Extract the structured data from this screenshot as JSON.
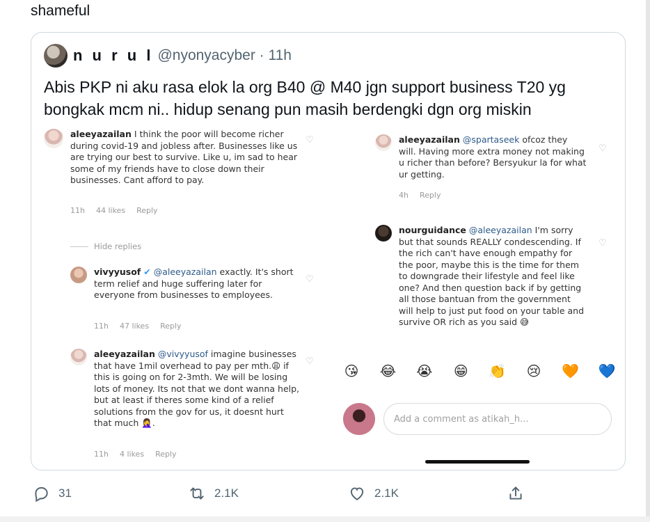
{
  "tweet": {
    "text": "shameful"
  },
  "quote": {
    "name": "n u r u l",
    "handle_time": "@nyonyacyber · 11h",
    "body": "Abis PKP ni aku rasa elok la org B40 @ M40 jgn support business T20 yg bongkak mcm ni.. hidup senang pun masih berdengki dgn org miskin"
  },
  "instagram": {
    "comments": [
      {
        "user": "aleeyazailan",
        "mention": "",
        "text": "I think the poor will become richer during covid-19 and jobless after. Businesses like us are trying our best to survive. Like u, im sad to hear some of my friends have to close down their businesses. Cant afford to pay.",
        "time": "11h",
        "likes": "44 likes",
        "reply": "Reply"
      },
      {
        "user": "vivyyusof",
        "mention": "@aleeyazailan",
        "text": "exactly. It's short term relief and huge suffering later for everyone from businesses to employees.",
        "time": "11h",
        "likes": "47 likes",
        "reply": "Reply"
      },
      {
        "user": "aleeyazailan",
        "mention": "@vivyyusof",
        "text": "imagine businesses that have 1mil overhead to pay per mth.😩 if this is going on for 2-3mth. We will be losing lots of money. Its not that we dont wanna help, but at least if theres some kind of a relief solutions from the gov for us, it doesnt hurt that much 🤦‍♀️.",
        "time": "11h",
        "likes": "4 likes",
        "reply": "Reply"
      },
      {
        "user": "aleeyazailan",
        "mention": "@spartaseek",
        "text": "ofcoz they will. Having more extra money not making u richer than before? Bersyukur la for what ur getting.",
        "time": "4h",
        "likes": "",
        "reply": "Reply"
      },
      {
        "user": "nourguidance",
        "mention": "@aleeyazailan",
        "text": "I'm sorry but that sounds REALLY condescending. If the rich can't have enough empathy for the poor, maybe this is the time for them to downgrade their lifestyle and feel like one? And then question back if by getting all those bantuan from the government will help to just put food on your table and survive OR rich as you said 😅",
        "time": "",
        "likes": "",
        "reply": ""
      }
    ],
    "hide_replies": "Hide replies",
    "emojis": [
      "😘",
      "😂",
      "😭",
      "😁",
      "👏",
      "😢",
      "🧡",
      "💙"
    ],
    "add_comment_placeholder": "Add a comment as atikah_h..."
  },
  "actions": {
    "replies": "31",
    "retweets": "2.1K",
    "likes": "2.1K"
  },
  "icons": {
    "reply": "reply-icon",
    "retweet": "retweet-icon",
    "like": "heart-icon",
    "share": "share-icon"
  }
}
